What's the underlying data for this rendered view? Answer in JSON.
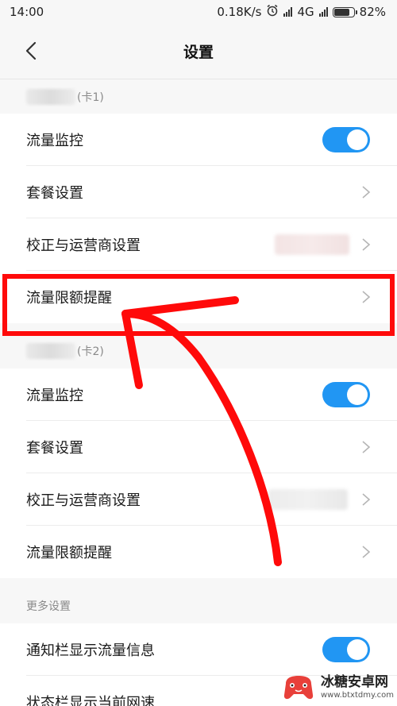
{
  "status_bar": {
    "time": "14:00",
    "net_speed": "0.18K/s",
    "network": "4G",
    "battery_pct": "82%",
    "battery_level": 0.82
  },
  "header": {
    "title": "设置"
  },
  "sim1": {
    "label": "(卡1)",
    "rows": {
      "monitor": "流量监控",
      "plan": "套餐设置",
      "calibrate": "校正与运营商设置",
      "limit": "流量限额提醒"
    }
  },
  "sim2": {
    "label": "(卡2)",
    "rows": {
      "monitor": "流量监控",
      "plan": "套餐设置",
      "calibrate": "校正与运营商设置",
      "limit": "流量限额提醒"
    }
  },
  "more": {
    "label": "更多设置",
    "rows": {
      "notify": "通知栏显示流量信息",
      "speed": "状态栏显示当前网速"
    }
  },
  "watermark": {
    "main": "冰糖安卓网",
    "sub": "www.btxtdmy.com"
  },
  "colors": {
    "toggle_on": "#2196f3",
    "annotation_red": "#ff0a0a"
  }
}
